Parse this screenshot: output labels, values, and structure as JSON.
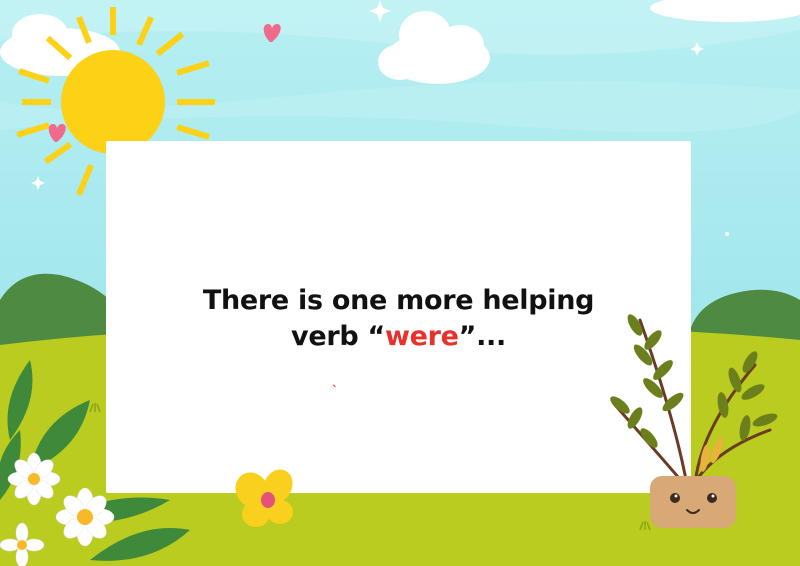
{
  "message": {
    "line1": "There is one more helping",
    "line2_prefix": "verb “",
    "line2_highlight": "were",
    "line2_suffix": "”...",
    "tick": "ˎ"
  },
  "colors": {
    "sky": "#a6ebef",
    "grass": "#b9cc1f",
    "hill": "#4e8a42",
    "sun": "#fcd116",
    "highlight": "#e8312b",
    "heart": "#f06a8c"
  },
  "icons": [
    "sun-icon",
    "cloud-icon",
    "heart-icon",
    "sparkle-icon",
    "flower-icon",
    "potted-plant-icon",
    "butterfly-flower-icon"
  ]
}
